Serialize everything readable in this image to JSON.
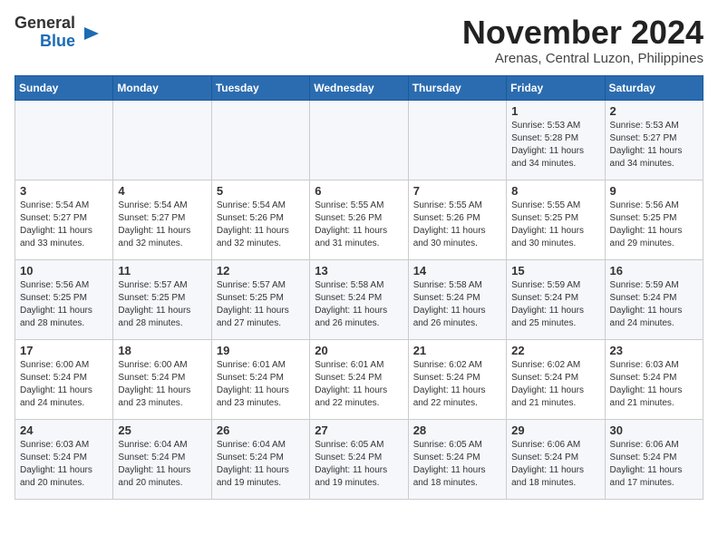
{
  "logo": {
    "line1": "General",
    "line2": "Blue"
  },
  "title": "November 2024",
  "location": "Arenas, Central Luzon, Philippines",
  "days_of_week": [
    "Sunday",
    "Monday",
    "Tuesday",
    "Wednesday",
    "Thursday",
    "Friday",
    "Saturday"
  ],
  "weeks": [
    [
      {
        "day": "",
        "info": ""
      },
      {
        "day": "",
        "info": ""
      },
      {
        "day": "",
        "info": ""
      },
      {
        "day": "",
        "info": ""
      },
      {
        "day": "",
        "info": ""
      },
      {
        "day": "1",
        "info": "Sunrise: 5:53 AM\nSunset: 5:28 PM\nDaylight: 11 hours and 34 minutes."
      },
      {
        "day": "2",
        "info": "Sunrise: 5:53 AM\nSunset: 5:27 PM\nDaylight: 11 hours and 34 minutes."
      }
    ],
    [
      {
        "day": "3",
        "info": "Sunrise: 5:54 AM\nSunset: 5:27 PM\nDaylight: 11 hours and 33 minutes."
      },
      {
        "day": "4",
        "info": "Sunrise: 5:54 AM\nSunset: 5:27 PM\nDaylight: 11 hours and 32 minutes."
      },
      {
        "day": "5",
        "info": "Sunrise: 5:54 AM\nSunset: 5:26 PM\nDaylight: 11 hours and 32 minutes."
      },
      {
        "day": "6",
        "info": "Sunrise: 5:55 AM\nSunset: 5:26 PM\nDaylight: 11 hours and 31 minutes."
      },
      {
        "day": "7",
        "info": "Sunrise: 5:55 AM\nSunset: 5:26 PM\nDaylight: 11 hours and 30 minutes."
      },
      {
        "day": "8",
        "info": "Sunrise: 5:55 AM\nSunset: 5:25 PM\nDaylight: 11 hours and 30 minutes."
      },
      {
        "day": "9",
        "info": "Sunrise: 5:56 AM\nSunset: 5:25 PM\nDaylight: 11 hours and 29 minutes."
      }
    ],
    [
      {
        "day": "10",
        "info": "Sunrise: 5:56 AM\nSunset: 5:25 PM\nDaylight: 11 hours and 28 minutes."
      },
      {
        "day": "11",
        "info": "Sunrise: 5:57 AM\nSunset: 5:25 PM\nDaylight: 11 hours and 28 minutes."
      },
      {
        "day": "12",
        "info": "Sunrise: 5:57 AM\nSunset: 5:25 PM\nDaylight: 11 hours and 27 minutes."
      },
      {
        "day": "13",
        "info": "Sunrise: 5:58 AM\nSunset: 5:24 PM\nDaylight: 11 hours and 26 minutes."
      },
      {
        "day": "14",
        "info": "Sunrise: 5:58 AM\nSunset: 5:24 PM\nDaylight: 11 hours and 26 minutes."
      },
      {
        "day": "15",
        "info": "Sunrise: 5:59 AM\nSunset: 5:24 PM\nDaylight: 11 hours and 25 minutes."
      },
      {
        "day": "16",
        "info": "Sunrise: 5:59 AM\nSunset: 5:24 PM\nDaylight: 11 hours and 24 minutes."
      }
    ],
    [
      {
        "day": "17",
        "info": "Sunrise: 6:00 AM\nSunset: 5:24 PM\nDaylight: 11 hours and 24 minutes."
      },
      {
        "day": "18",
        "info": "Sunrise: 6:00 AM\nSunset: 5:24 PM\nDaylight: 11 hours and 23 minutes."
      },
      {
        "day": "19",
        "info": "Sunrise: 6:01 AM\nSunset: 5:24 PM\nDaylight: 11 hours and 23 minutes."
      },
      {
        "day": "20",
        "info": "Sunrise: 6:01 AM\nSunset: 5:24 PM\nDaylight: 11 hours and 22 minutes."
      },
      {
        "day": "21",
        "info": "Sunrise: 6:02 AM\nSunset: 5:24 PM\nDaylight: 11 hours and 22 minutes."
      },
      {
        "day": "22",
        "info": "Sunrise: 6:02 AM\nSunset: 5:24 PM\nDaylight: 11 hours and 21 minutes."
      },
      {
        "day": "23",
        "info": "Sunrise: 6:03 AM\nSunset: 5:24 PM\nDaylight: 11 hours and 21 minutes."
      }
    ],
    [
      {
        "day": "24",
        "info": "Sunrise: 6:03 AM\nSunset: 5:24 PM\nDaylight: 11 hours and 20 minutes."
      },
      {
        "day": "25",
        "info": "Sunrise: 6:04 AM\nSunset: 5:24 PM\nDaylight: 11 hours and 20 minutes."
      },
      {
        "day": "26",
        "info": "Sunrise: 6:04 AM\nSunset: 5:24 PM\nDaylight: 11 hours and 19 minutes."
      },
      {
        "day": "27",
        "info": "Sunrise: 6:05 AM\nSunset: 5:24 PM\nDaylight: 11 hours and 19 minutes."
      },
      {
        "day": "28",
        "info": "Sunrise: 6:05 AM\nSunset: 5:24 PM\nDaylight: 11 hours and 18 minutes."
      },
      {
        "day": "29",
        "info": "Sunrise: 6:06 AM\nSunset: 5:24 PM\nDaylight: 11 hours and 18 minutes."
      },
      {
        "day": "30",
        "info": "Sunrise: 6:06 AM\nSunset: 5:24 PM\nDaylight: 11 hours and 17 minutes."
      }
    ]
  ]
}
